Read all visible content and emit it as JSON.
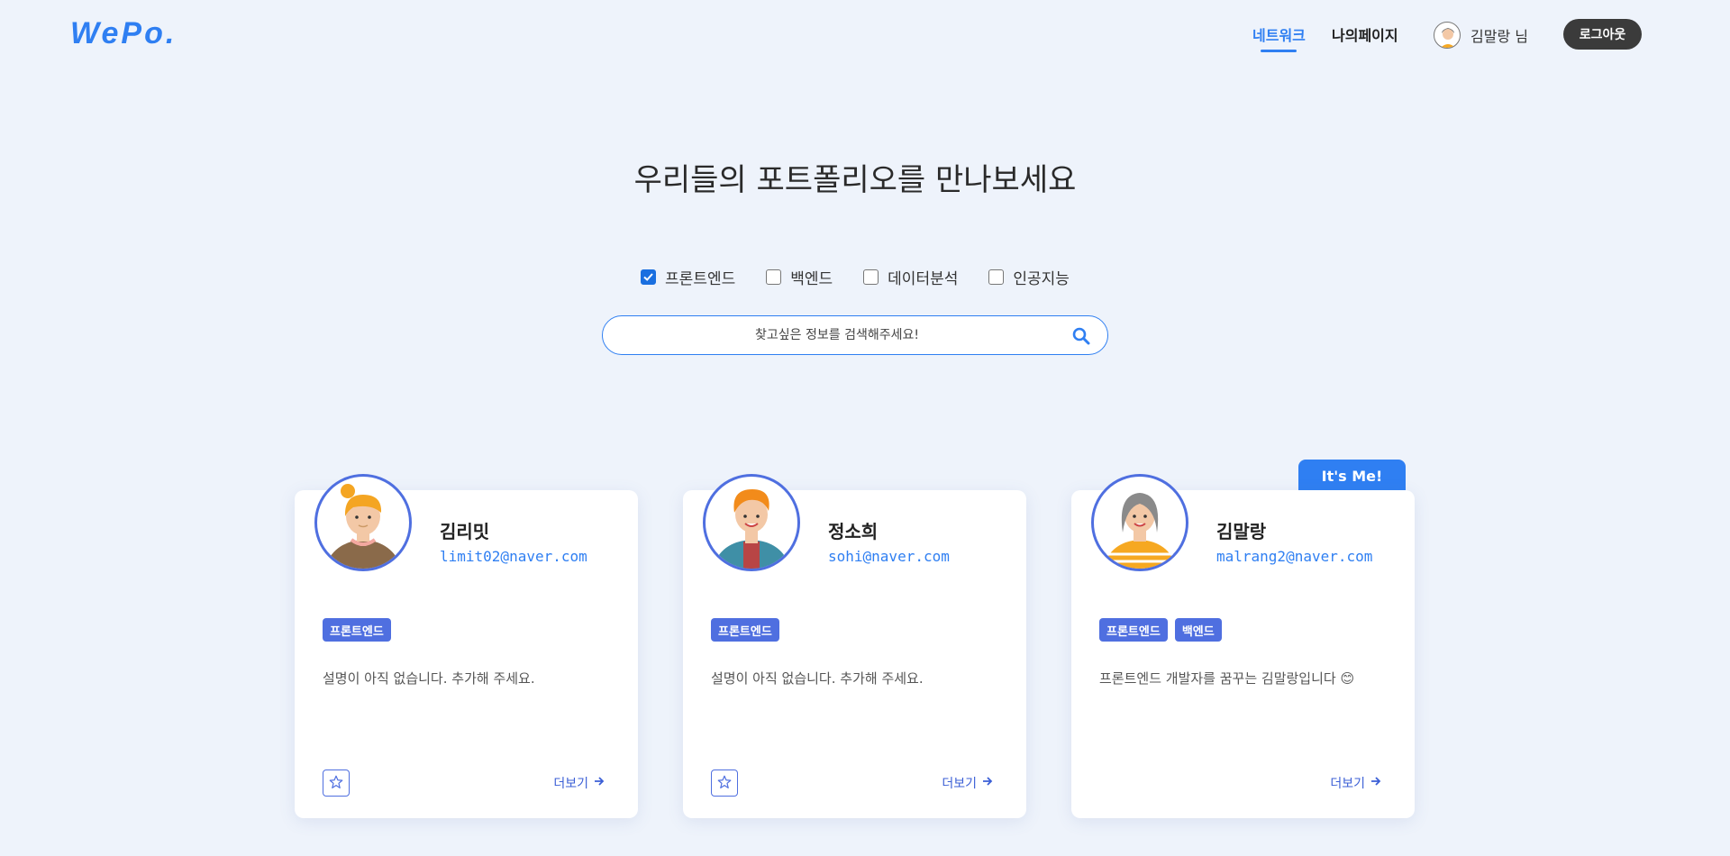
{
  "header": {
    "logo": "WePo.",
    "nav": {
      "network": "네트워크",
      "mypage": "나의페이지",
      "username": "김말랑 님",
      "logout": "로그아웃"
    }
  },
  "hero": {
    "title": "우리들의 포트폴리오를 만나보세요"
  },
  "filters": [
    {
      "label": "프론트엔드",
      "checked": true
    },
    {
      "label": "백엔드",
      "checked": false
    },
    {
      "label": "데이터분석",
      "checked": false
    },
    {
      "label": "인공지능",
      "checked": false
    }
  ],
  "search": {
    "placeholder": "찾고싶은 정보를 검색해주세요!"
  },
  "cards": [
    {
      "name": "김리밋",
      "email": "limit02@naver.com",
      "tags": [
        "프론트엔드"
      ],
      "description": "설명이 아직 없습니다. 추가해 주세요.",
      "more": "더보기",
      "is_me": false
    },
    {
      "name": "정소희",
      "email": "sohi@naver.com",
      "tags": [
        "프론트엔드"
      ],
      "description": "설명이 아직 없습니다. 추가해 주세요.",
      "more": "더보기",
      "is_me": false
    },
    {
      "name": "김말랑",
      "email": "malrang2@naver.com",
      "tags": [
        "프론트엔드",
        "백엔드"
      ],
      "description": "프론트엔드 개발자를 꿈꾸는 김말랑입니다 😊",
      "more": "더보기",
      "is_me": true
    }
  ],
  "me_badge": "It's Me!",
  "colors": {
    "accent": "#2f7ff2",
    "tag": "#4f6fe0",
    "background": "#eef3fb",
    "logout_bg": "#3b3b3b"
  }
}
